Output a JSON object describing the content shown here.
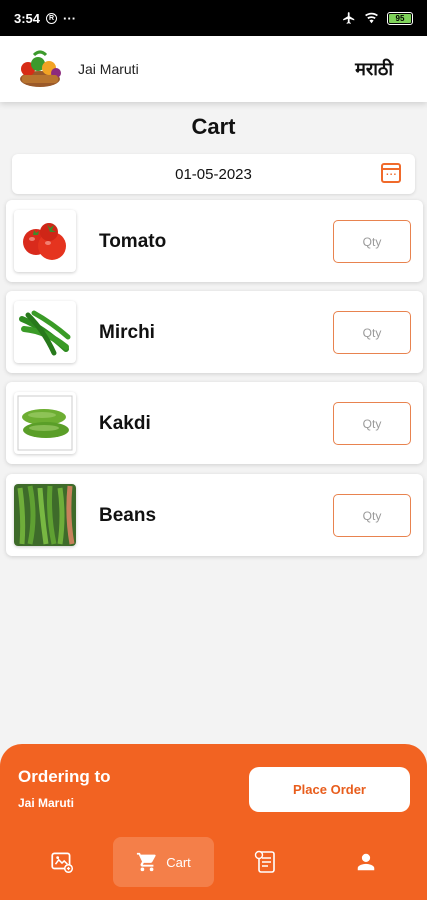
{
  "status_bar": {
    "time": "3:54",
    "battery": "95"
  },
  "header": {
    "shop_name": "Jai Maruti",
    "language_toggle": "मराठी"
  },
  "page": {
    "title": "Cart",
    "date": "01-05-2023"
  },
  "items": [
    {
      "name": "Tomato",
      "qty_placeholder": "Qty"
    },
    {
      "name": "Mirchi",
      "qty_placeholder": "Qty"
    },
    {
      "name": "Kakdi",
      "qty_placeholder": "Qty"
    },
    {
      "name": "Beans",
      "qty_placeholder": "Qty"
    }
  ],
  "footer": {
    "ordering_label": "Ordering to",
    "ordering_shop": "Jai Maruti",
    "place_order_label": "Place Order"
  },
  "nav": {
    "items": [
      {
        "icon": "products-icon",
        "label": ""
      },
      {
        "icon": "cart-icon",
        "label": "Cart"
      },
      {
        "icon": "orders-icon",
        "label": ""
      },
      {
        "icon": "profile-icon",
        "label": ""
      }
    ],
    "active_index": 1
  },
  "colors": {
    "accent": "#f26322",
    "status_bar": "#000000"
  }
}
